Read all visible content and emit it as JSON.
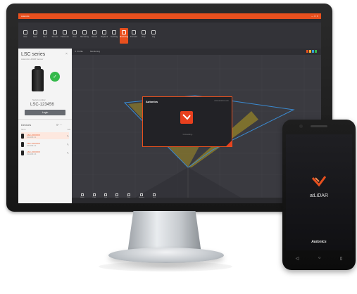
{
  "app": {
    "title": "Autonics",
    "window_controls": "— ☐ ✕"
  },
  "toolbar": {
    "tools": [
      {
        "label": "New",
        "active": false
      },
      {
        "label": "Open",
        "active": false
      },
      {
        "label": "Save",
        "active": false
      },
      {
        "label": "Save as",
        "active": false
      },
      {
        "label": "Parameter",
        "active": false
      },
      {
        "label": "Zone",
        "active": false
      },
      {
        "label": "Monitoring",
        "active": false
      },
      {
        "label": "Record",
        "active": false
      },
      {
        "label": "Playback",
        "active": false
      },
      {
        "label": "Teaching",
        "active": false
      },
      {
        "label": "Measuring",
        "active": true
      },
      {
        "label": "Firmware",
        "active": false
      },
      {
        "label": "Help",
        "active": false
      },
      {
        "label": "Log",
        "active": false
      }
    ]
  },
  "sidebar": {
    "title": "LSC series",
    "subtitle": "Autonics LiDAR Sensor",
    "close_icon": "×",
    "serial_label": "Serial number",
    "serial_value": "LSC-123456",
    "connect_label": "Login",
    "list_header": "Devices",
    "list_icons": "⟳ ⋯",
    "col_name": "Name",
    "col_edit": "Edit",
    "devices": [
      {
        "name": "LSC-XXXXXX",
        "ip": "192.168.0.1",
        "edit": "✎"
      },
      {
        "name": "LSC-XXXXXX",
        "ip": "192.168.0.2",
        "edit": "✎"
      },
      {
        "name": "LSC-XXXXXX",
        "ip": "192.168.0.3",
        "edit": "✎"
      }
    ]
  },
  "canvas": {
    "tab_a": "✕ Profile",
    "tab_b": "Monitoring",
    "legend_colors": [
      "#e8501e",
      "#f2b632",
      "#3a9ad9",
      "#34b94a"
    ]
  },
  "bottom_tools": [
    {
      "label": "Select"
    },
    {
      "label": "Point"
    },
    {
      "label": "Line"
    },
    {
      "label": "Area"
    },
    {
      "label": "Clear"
    },
    {
      "label": "Measure"
    },
    {
      "label": "Grid"
    }
  ],
  "dialog": {
    "title": "Autonics",
    "link": "www.autonics.com",
    "caption": "Connecting..."
  },
  "phone": {
    "app_name": "atLiDAR",
    "brand": "Autonics",
    "nav": {
      "back": "◁",
      "home": "○",
      "recent": "▯"
    }
  },
  "colors": {
    "accent": "#e8501e",
    "zone_fill": "#8a7a2c",
    "zone_outline": "#3a8ad0",
    "status_ok": "#34b94a"
  }
}
